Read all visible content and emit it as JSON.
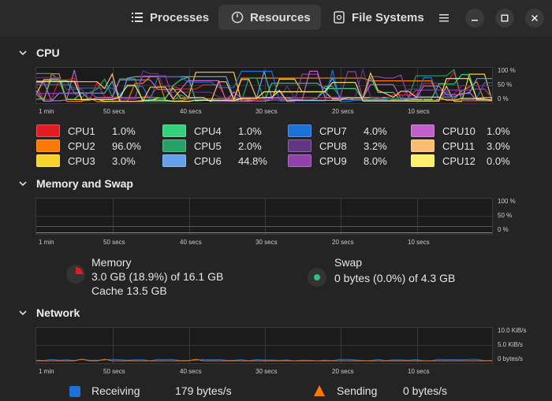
{
  "header": {
    "tabs": [
      {
        "label": "Processes",
        "icon": "list-icon"
      },
      {
        "label": "Resources",
        "icon": "gauge-icon",
        "active": true
      },
      {
        "label": "File Systems",
        "icon": "disk-icon"
      }
    ],
    "menu_icon": "hamburger-menu-icon",
    "window_buttons": [
      "minimize",
      "maximize",
      "close"
    ]
  },
  "cpu": {
    "title": "CPU",
    "y_labels": [
      "100 %",
      "50 %",
      "0 %"
    ],
    "x_labels": [
      "1 min",
      "50 secs",
      "40 secs",
      "30 secs",
      "20 secs",
      "10 secs"
    ],
    "cores": [
      {
        "name": "CPU1",
        "value": "1.0%",
        "color": "#e01b24"
      },
      {
        "name": "CPU2",
        "value": "96.0%",
        "color": "#ff7800"
      },
      {
        "name": "CPU3",
        "value": "3.0%",
        "color": "#f6d32d"
      },
      {
        "name": "CPU4",
        "value": "1.0%",
        "color": "#33d17a"
      },
      {
        "name": "CPU5",
        "value": "2.0%",
        "color": "#26a269"
      },
      {
        "name": "CPU6",
        "value": "44.8%",
        "color": "#62a0ea"
      },
      {
        "name": "CPU7",
        "value": "4.0%",
        "color": "#1c71d8"
      },
      {
        "name": "CPU8",
        "value": "3.2%",
        "color": "#613583"
      },
      {
        "name": "CPU9",
        "value": "8.0%",
        "color": "#9141ac"
      },
      {
        "name": "CPU10",
        "value": "1.0%",
        "color": "#c061cb"
      },
      {
        "name": "CPU11",
        "value": "3.0%",
        "color": "#ffbe6f"
      },
      {
        "name": "CPU12",
        "value": "0.0%",
        "color": "#f9f06b"
      }
    ]
  },
  "memory": {
    "title": "Memory and Swap",
    "y_labels": [
      "100 %",
      "50 %",
      "0 %"
    ],
    "x_labels": [
      "1 min",
      "50 secs",
      "40 secs",
      "30 secs",
      "20 secs",
      "10 secs"
    ],
    "memory_label": "Memory",
    "memory_usage": "3.0 GB (18.9%) of 16.1 GB",
    "memory_cache": "Cache 13.5 GB",
    "memory_color": "#e01b24",
    "memory_fraction": 0.189,
    "swap_label": "Swap",
    "swap_usage": "0 bytes (0.0%) of 4.3 GB",
    "swap_color": "#2ec27e",
    "swap_fraction": 0.0
  },
  "network": {
    "title": "Network",
    "y_labels": [
      "10.0 KiB/s",
      "5.0 KiB/s",
      "0 bytes/s"
    ],
    "x_labels": [
      "1 min",
      "50 secs",
      "40 secs",
      "30 secs",
      "20 secs",
      "10 secs"
    ],
    "receiving_label": "Receiving",
    "receiving_value": "179 bytes/s",
    "receiving_color": "#1c71d8",
    "sending_label": "Sending",
    "sending_value": "0 bytes/s",
    "sending_color": "#ff7800"
  }
}
